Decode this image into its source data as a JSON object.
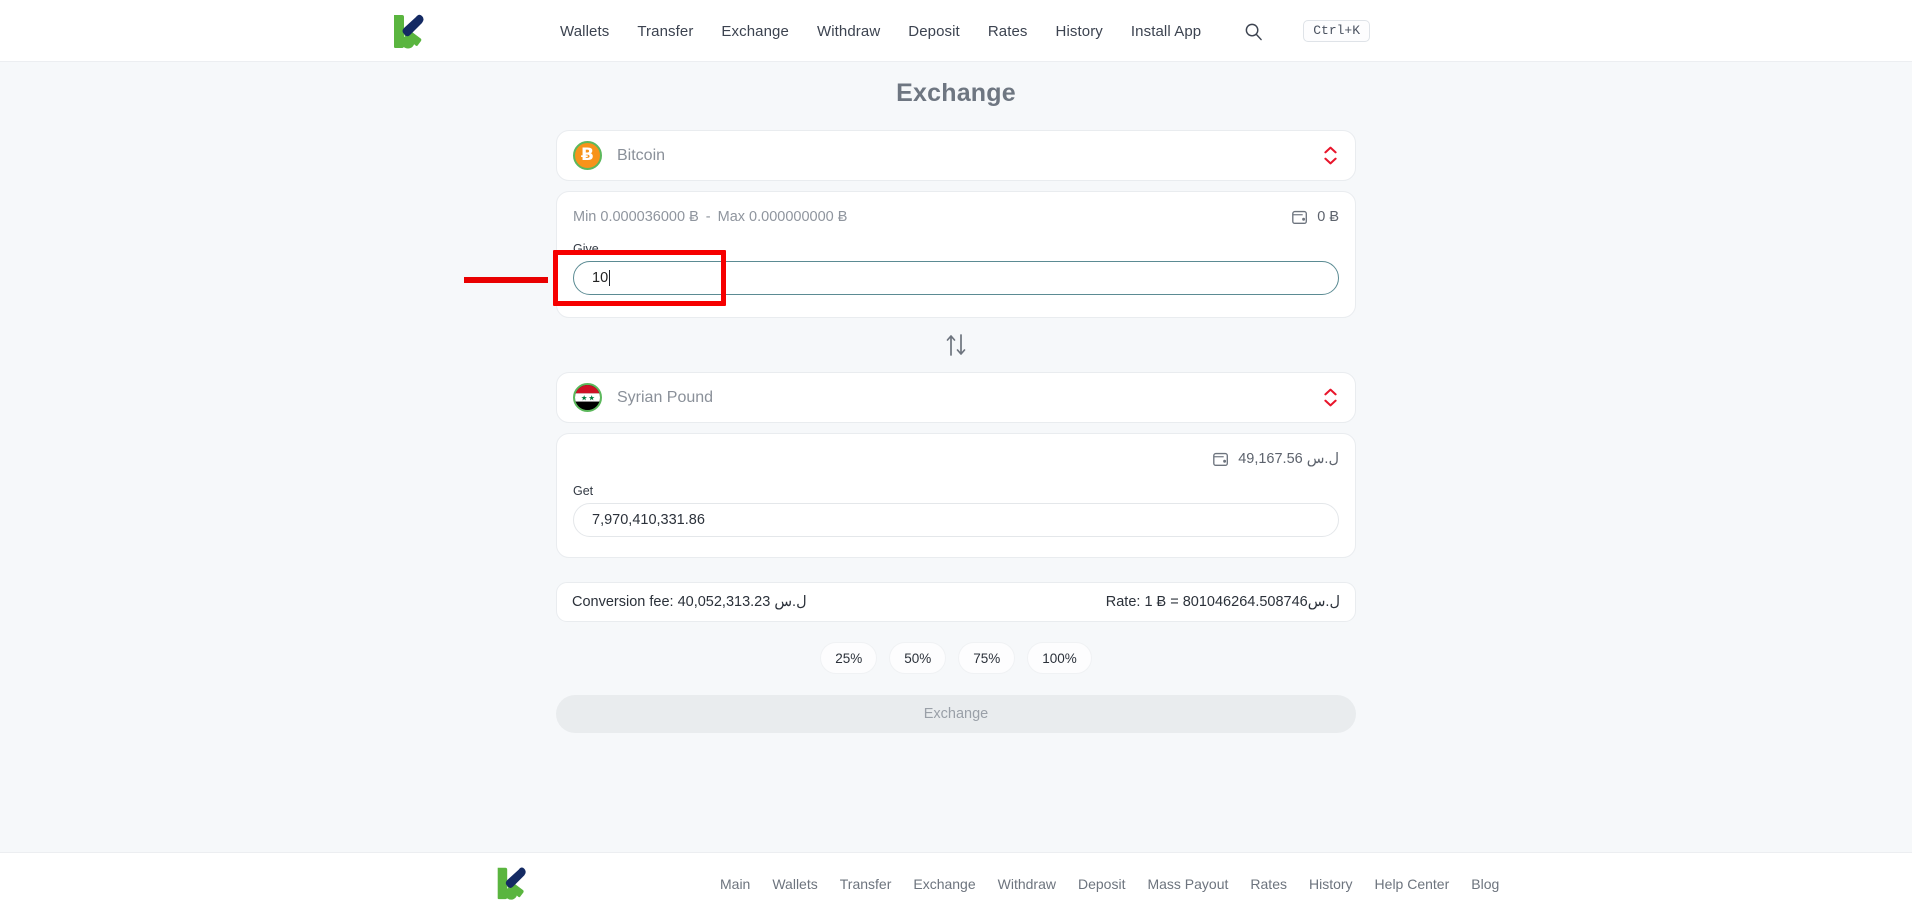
{
  "header": {
    "logo_name": "kuna-logo",
    "nav": [
      {
        "label": "Wallets"
      },
      {
        "label": "Transfer"
      },
      {
        "label": "Exchange"
      },
      {
        "label": "Withdraw"
      },
      {
        "label": "Deposit"
      },
      {
        "label": "Rates"
      },
      {
        "label": "History"
      },
      {
        "label": "Install App"
      }
    ],
    "search_icon": "search-icon",
    "shortcut_badge": "Ctrl+K"
  },
  "main": {
    "title": "Exchange",
    "from": {
      "currency_name": "Bitcoin",
      "currency_icon": "bitcoin-icon",
      "icon_symbol": "Ƀ",
      "min_label": "Min 0.000036000 Ƀ",
      "separator": "-",
      "max_label": "Max 0.000000000 Ƀ",
      "balance": "0 Ƀ",
      "wallet_icon": "wallet-icon",
      "field_label": "Give",
      "field_value": "10",
      "field_placeholder": ""
    },
    "swap_icon": "swap-vertical-icon",
    "to": {
      "currency_name": "Syrian Pound",
      "currency_icon": "syria-flag-icon",
      "balance": "49,167.56 ل.س",
      "wallet_icon": "wallet-icon",
      "field_label": "Get",
      "field_value": "7,970,410,331.86",
      "field_placeholder": ""
    },
    "fee": {
      "conversion_fee": "Conversion fee: 40,052,313.23 ل.س",
      "rate": "Rate: 1 Ƀ = 801046264.508746ل.س"
    },
    "percent_buttons": [
      {
        "label": "25%"
      },
      {
        "label": "50%"
      },
      {
        "label": "75%"
      },
      {
        "label": "100%"
      }
    ],
    "submit_label": "Exchange"
  },
  "footer": {
    "logo_name": "kuna-logo",
    "links": [
      {
        "label": "Main"
      },
      {
        "label": "Wallets"
      },
      {
        "label": "Transfer"
      },
      {
        "label": "Exchange"
      },
      {
        "label": "Withdraw"
      },
      {
        "label": "Deposit"
      },
      {
        "label": "Mass Payout"
      },
      {
        "label": "Rates"
      },
      {
        "label": "History"
      },
      {
        "label": "Help Center"
      },
      {
        "label": "Blog"
      }
    ]
  },
  "annotation": {
    "highlight_color": "#f60000",
    "pointer_color": "#e90000",
    "target": "give-amount-input"
  }
}
